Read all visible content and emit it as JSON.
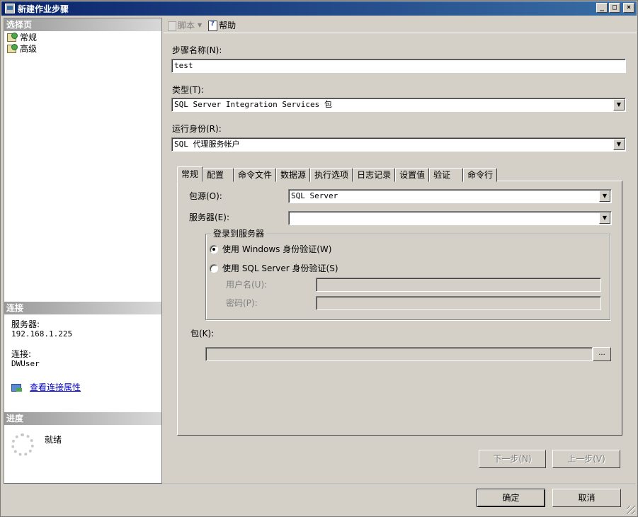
{
  "window": {
    "title": "新建作业步骤"
  },
  "left": {
    "select_page_header": "选择页",
    "pages": [
      {
        "label": "常规"
      },
      {
        "label": "高级"
      }
    ],
    "connection_header": "连接",
    "server_label": "服务器:",
    "server_value": "192.168.1.225",
    "connection_label": "连接:",
    "connection_value": "DWUser",
    "view_connection_link": "查看连接属性",
    "progress_header": "进度",
    "progress_status": "就绪"
  },
  "toolbar": {
    "script_label": "脚本",
    "help_label": "帮助"
  },
  "form": {
    "step_name_label": "步骤名称(N):",
    "step_name_value": "test",
    "type_label": "类型(T):",
    "type_value": "SQL Server Integration Services 包",
    "run_as_label": "运行身份(R):",
    "run_as_value": "SQL 代理服务帐户"
  },
  "tabs": [
    {
      "label": "常规",
      "active": true
    },
    {
      "label": "配置"
    },
    {
      "label": "命令文件"
    },
    {
      "label": "数据源"
    },
    {
      "label": "执行选项"
    },
    {
      "label": "日志记录"
    },
    {
      "label": "设置值"
    },
    {
      "label": "验证"
    },
    {
      "label": "命令行"
    }
  ],
  "general_tab": {
    "package_source_label": "包源(O):",
    "package_source_value": "SQL Server",
    "server_label": "服务器(E):",
    "server_value": "",
    "login_group_title": "登录到服务器",
    "windows_auth_label": "使用 Windows 身份验证(W)",
    "windows_auth_checked": true,
    "sql_auth_label": "使用 SQL Server 身份验证(S)",
    "sql_auth_checked": false,
    "username_label": "用户名(U):",
    "password_label": "密码(P):",
    "package_label": "包(K):",
    "browse_label": "..."
  },
  "buttons": {
    "next_step": "下一步(N)",
    "prev_step": "上一步(V)",
    "ok": "确定",
    "cancel": "取消"
  }
}
